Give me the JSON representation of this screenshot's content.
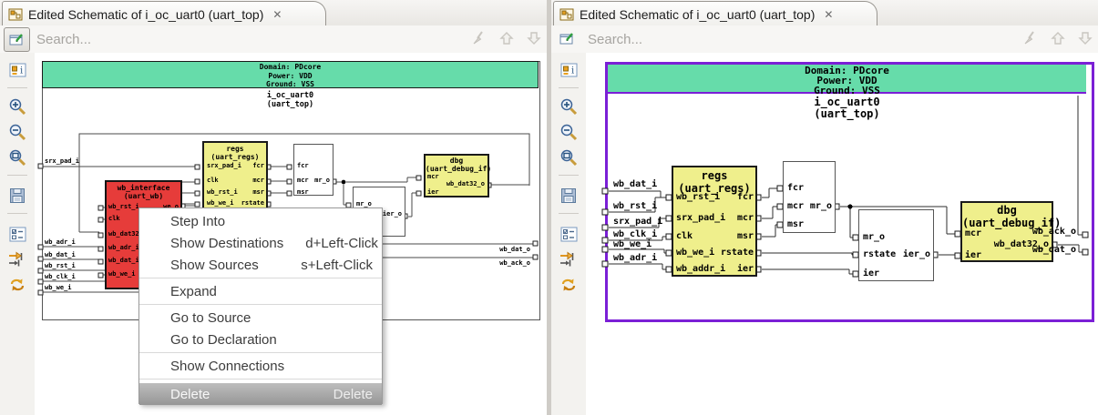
{
  "tab_title": "Edited Schematic of i_oc_uart0 (uart_top)",
  "tab_close_glyph": "✕",
  "search_placeholder": "Search...",
  "toolbar_icons": [
    "schematic-edit",
    "schematic-info",
    "zoom-in",
    "zoom-out",
    "zoom-fit",
    "save",
    "display-options",
    "trace-signal",
    "swap-buffers"
  ],
  "search_icons": [
    "clear-highlight",
    "find-previous",
    "find-next"
  ],
  "colors": {
    "domain_band": "#66dcaa",
    "block_yellow": "#efef8c",
    "block_red": "#e63c3a",
    "selected_border_purple": "#7b1fd6",
    "menu_selected_gray": "#a8a8a8"
  },
  "left": {
    "header": [
      "Domain: PDcore",
      "Power: VDD",
      "Ground: VSS"
    ],
    "instance": "i_oc_uart0",
    "module": "(uart_top)",
    "inputs": [
      "srx_pad_i",
      "wb_adr_i",
      "wb_dat_i",
      "wb_rst_i",
      "wb_clk_i",
      "wb_we_i"
    ],
    "outputs": [
      "wb_dat_o",
      "wb_ack_o"
    ],
    "wb_interface": {
      "title": "wb_interface",
      "module": "(uart_wb)",
      "lports": [
        "wb_rst_i",
        "clk",
        "wb_dat32_o",
        "wb_adr_i",
        "wb_dat_i",
        "wb_we_i"
      ],
      "rports": [
        "we_o"
      ]
    },
    "regs": {
      "title": "regs",
      "module": "(uart_regs)",
      "lports": [
        "srx_pad_i",
        "clk",
        "wb_rst_i",
        "wb_we_i"
      ],
      "rports": [
        "fcr",
        "mcr",
        "msr",
        "rstate"
      ]
    },
    "comb1": {
      "lports": [
        "fcr",
        "mcr",
        "msr"
      ],
      "rports": [
        "mr_o"
      ]
    },
    "comb2": {
      "lports": [
        "mr_o"
      ],
      "rports": [
        "ier_o"
      ]
    },
    "dbg": {
      "title": "dbg",
      "module": "(uart_debug_if)",
      "lports": [
        "mcr",
        "ier"
      ],
      "rports": [
        "wb_dat32_o"
      ]
    }
  },
  "right": {
    "header": [
      "Domain: PDcore",
      "Power: VDD",
      "Ground: VSS"
    ],
    "instance": "i_oc_uart0",
    "module": "(uart_top)",
    "inputs": [
      "wb_dat_i",
      "wb_rst_i",
      "srx_pad_i",
      "wb_clk_i",
      "wb_we_i",
      "wb_adr_i"
    ],
    "outputs": [
      "wb_ack_o",
      "wb_dat_o"
    ],
    "regs": {
      "title": "regs",
      "module": "(uart_regs)",
      "lports": [
        "wb_rst_i",
        "srx_pad_i",
        "clk",
        "wb_we_i",
        "wb_addr_i"
      ],
      "rports": [
        "fcr",
        "mcr",
        "msr",
        "rstate",
        "ier"
      ]
    },
    "comb1": {
      "lports": [
        "fcr",
        "mcr",
        "msr"
      ],
      "rports": [
        "mr_o"
      ]
    },
    "comb2": {
      "lports": [
        "mr_o",
        "rstate",
        "ier"
      ],
      "rports": [
        "ier_o"
      ]
    },
    "dbg": {
      "title": "dbg",
      "module": "(uart_debug_if)",
      "lports": [
        "mcr",
        "ier"
      ],
      "rports": [
        "wb_dat32_o"
      ]
    }
  },
  "menu": {
    "selected_item": "Delete",
    "items": [
      {
        "label": "Step Into",
        "shortcut": ""
      },
      {
        "label": "Show Destinations",
        "shortcut": "d+Left-Click"
      },
      {
        "label": "Show Sources",
        "shortcut": "s+Left-Click"
      },
      {
        "label": "Expand",
        "shortcut": ""
      },
      {
        "label": "Go to Source",
        "shortcut": ""
      },
      {
        "label": "Go to Declaration",
        "shortcut": ""
      },
      {
        "label": "Show Connections",
        "shortcut": ""
      },
      {
        "label": "Delete",
        "shortcut": "Delete"
      }
    ]
  }
}
